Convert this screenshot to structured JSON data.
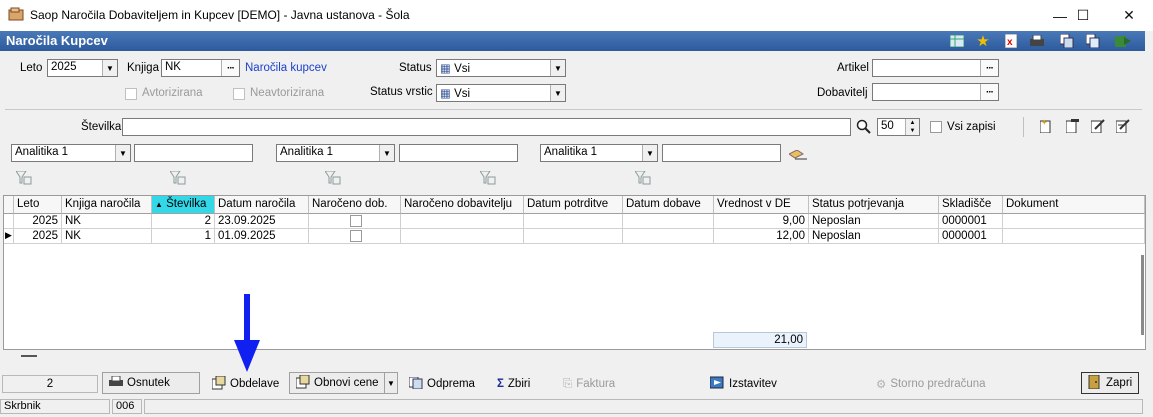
{
  "window": {
    "title": "Saop  Naročila Dobaviteljem in Kupcev [DEMO] - Javna ustanova - Šola",
    "minimize": "—",
    "maximize": "☐",
    "close": "✕"
  },
  "header": {
    "title": "Naročila Kupcev"
  },
  "filters": {
    "leto_label": "Leto",
    "leto_value": "2025",
    "knjiga_label": "Knjiga",
    "knjiga_value": "NK",
    "knjiga_desc": "Naročila kupcev",
    "avtorizirana": "Avtorizirana",
    "neavtorizirana": "Neavtorizirana",
    "status_label": "Status",
    "status_value": "Vsi",
    "status_vrstic_label": "Status vrstic",
    "status_vrstic_value": "Vsi",
    "artikel_label": "Artikel",
    "dobavitelj_label": "Dobavitelj",
    "stevilka_label": "Številka",
    "limit_value": "50",
    "vsi_zapisi": "Vsi zapisi",
    "analitika1": "Analitika 1",
    "analitika2": "Analitika 1",
    "analitika3": "Analitika 1"
  },
  "grid": {
    "columns": [
      "Leto",
      "Knjiga naročila",
      "Številka",
      "Datum naročila",
      "Naročeno dob.",
      "Naročeno dobavitelju",
      "Datum potrditve",
      "Datum dobave",
      "Vrednost v DE",
      "Status potrjevanja",
      "Skladišče",
      "Dokument"
    ],
    "rows": [
      {
        "leto": "2025",
        "knjiga": "NK",
        "stevilka": "2",
        "datum": "23.09.2025",
        "vrednost": "9,00",
        "status": "Neposlan",
        "skladisce": "0000001"
      },
      {
        "leto": "2025",
        "knjiga": "NK",
        "stevilka": "1",
        "datum": "01.09.2025",
        "vrednost": "12,00",
        "status": "Neposlan",
        "skladisce": "0000001"
      }
    ],
    "total": "21,00",
    "count": "2"
  },
  "toolbar": {
    "osnutek": "Osnutek",
    "obdelave": "Obdelave",
    "obnovi_cene": "Obnovi cene",
    "odprema": "Odprema",
    "zbiri": "Zbiri",
    "faktura": "Faktura",
    "izstavitev": "Izstavitev",
    "storno": "Storno predračuna",
    "zapri": "Zapri"
  },
  "statusbar": {
    "user": "Skrbnik",
    "code": "006"
  },
  "colors": {
    "header_blue": "#2c5a9c",
    "sorted_col": "#33d8e8",
    "link_blue": "#1a3fcc",
    "arrow_blue": "#1020f0"
  }
}
